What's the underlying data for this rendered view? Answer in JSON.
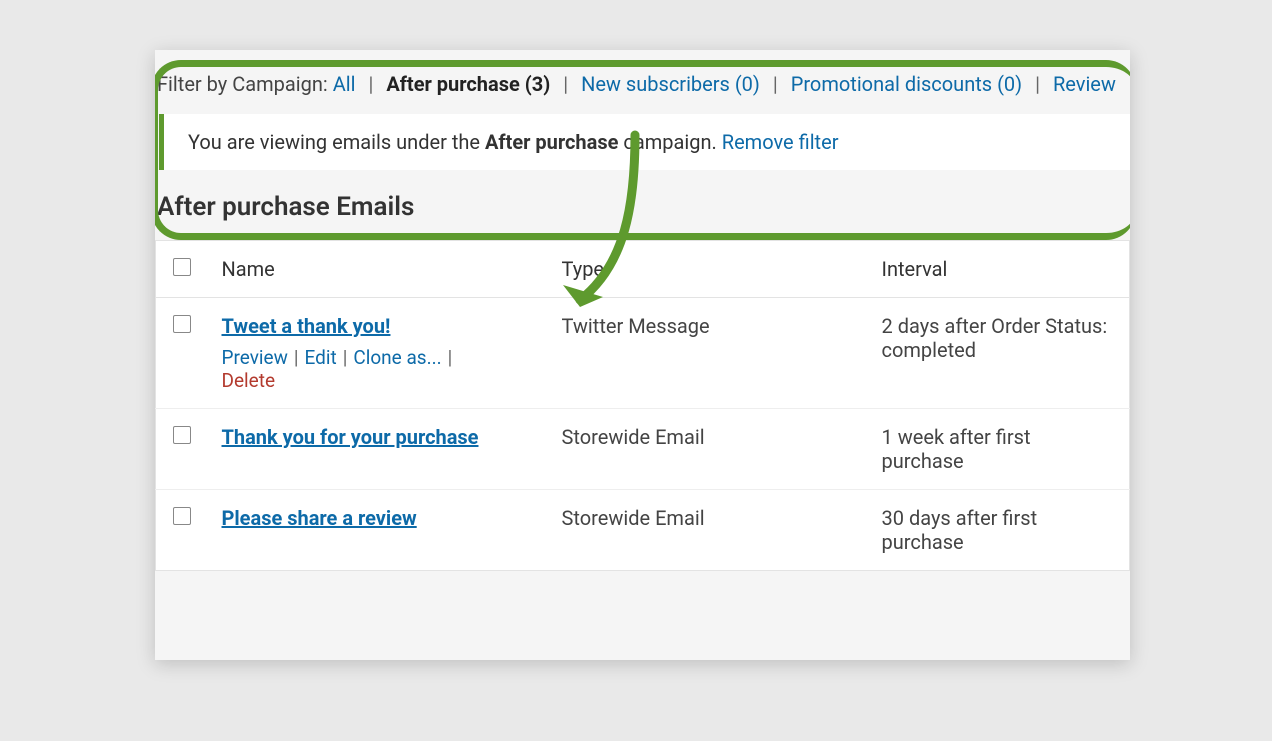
{
  "filter": {
    "label": "Filter by Campaign:",
    "options": {
      "all": "All",
      "after_purchase": "After purchase (3)",
      "new_subscribers": "New subscribers (0)",
      "promotional_discounts": "Promotional discounts (0)",
      "review": "Review"
    }
  },
  "info": {
    "prefix": "You are viewing emails under the ",
    "campaign": "After purchase",
    "suffix": " campaign. ",
    "remove": "Remove filter"
  },
  "page_title": "After purchase Emails",
  "columns": {
    "name": "Name",
    "type": "Type",
    "interval": "Interval"
  },
  "rows": [
    {
      "name": "Tweet a thank you!",
      "type": "Twitter Message",
      "interval": "2 days after Order Status: completed",
      "actions": {
        "preview": "Preview",
        "edit": "Edit",
        "clone": "Clone as...",
        "delete": "Delete"
      }
    },
    {
      "name": "Thank you for your purchase",
      "type": "Storewide Email",
      "interval": "1 week after first purchase"
    },
    {
      "name": "Please share a review",
      "type": "Storewide Email",
      "interval": "30 days after first purchase"
    }
  ]
}
